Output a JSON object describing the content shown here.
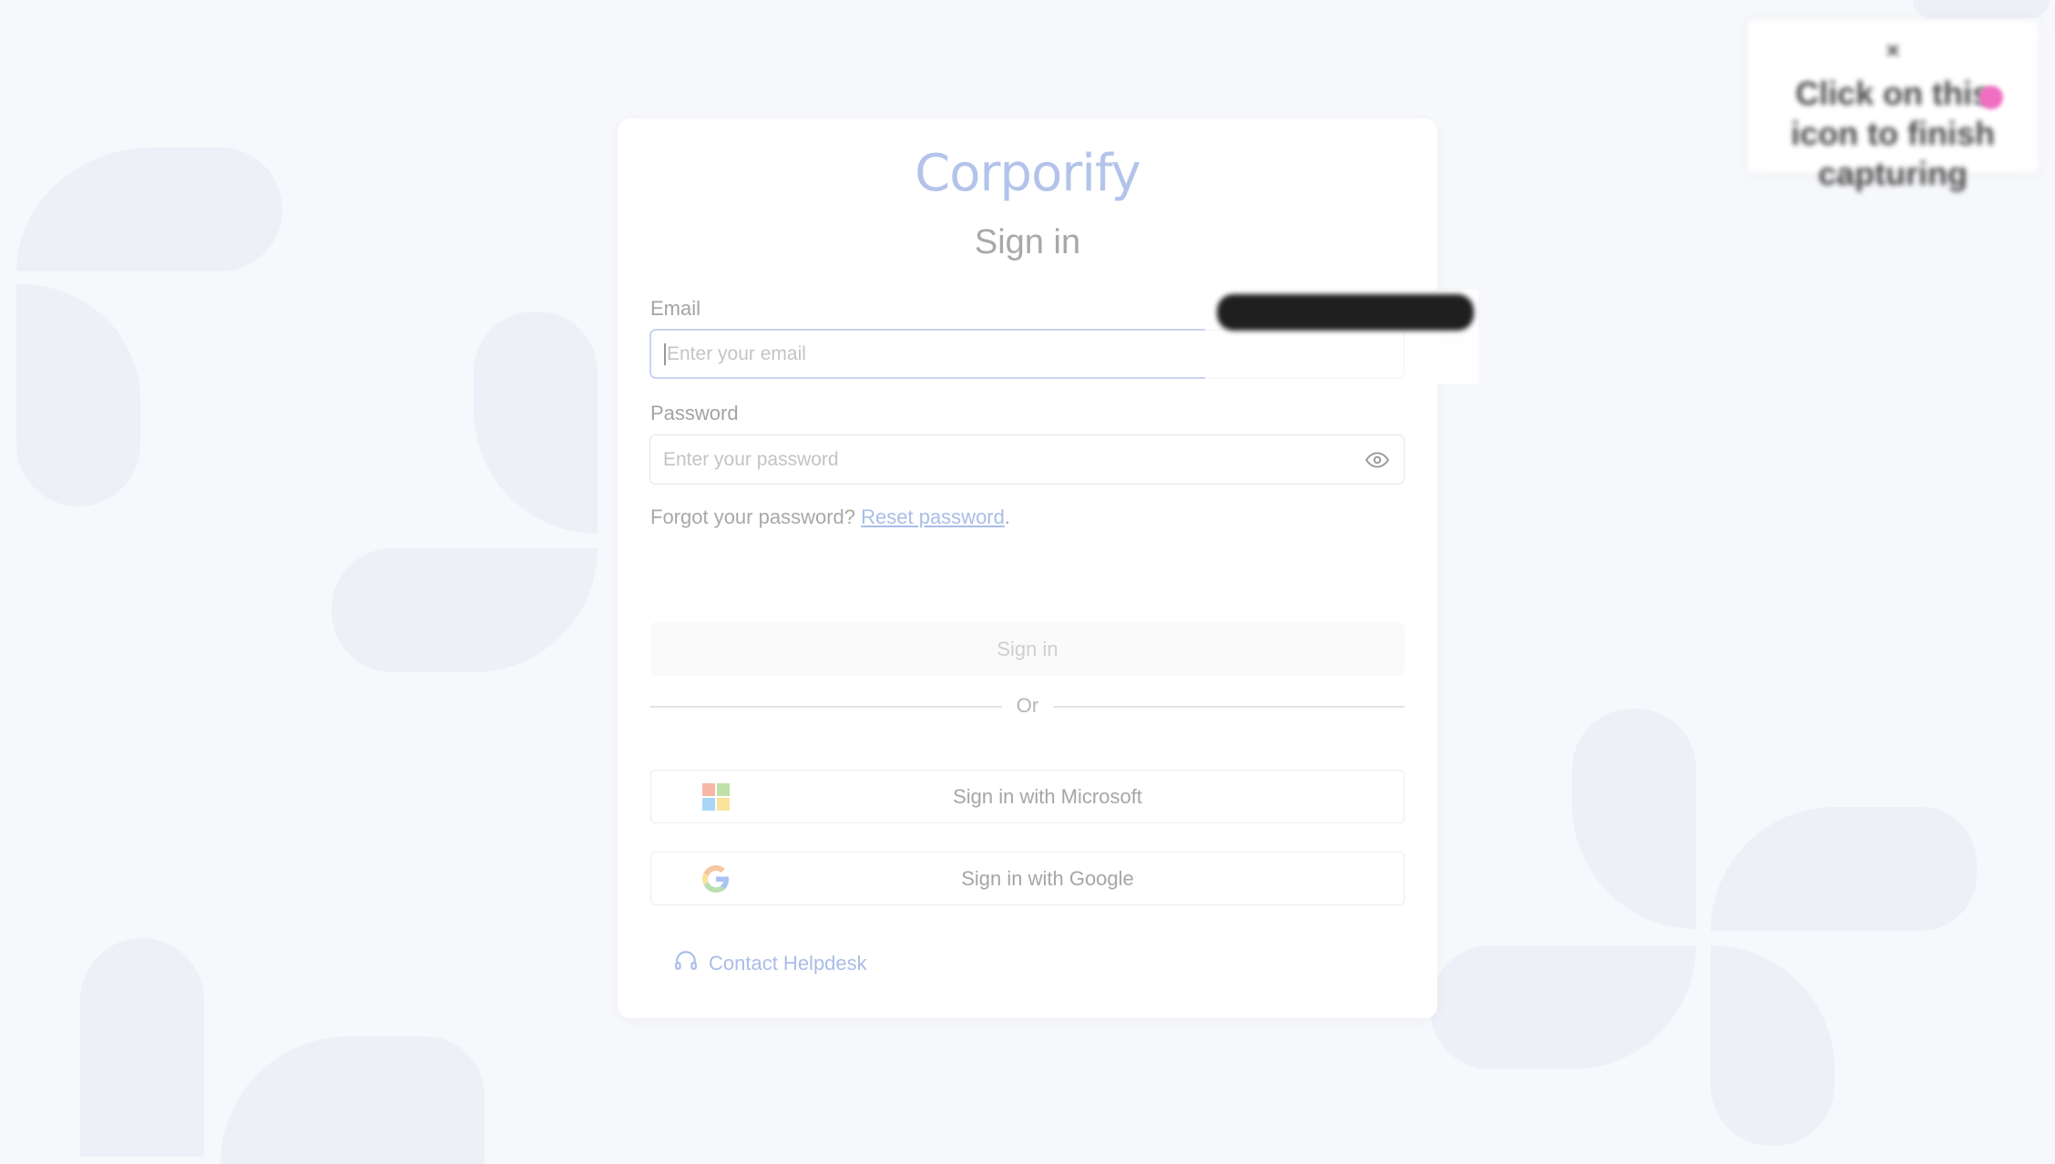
{
  "brand": {
    "logo_text": "Corporify"
  },
  "form": {
    "title": "Sign in",
    "email_label": "Email",
    "email_placeholder": "Enter your email",
    "password_label": "Password",
    "password_placeholder": "Enter your password",
    "forgot_text": "Forgot your password?",
    "reset_link": "Reset password",
    "reset_suffix": ".",
    "signin_button": "Sign in",
    "divider_text": "Or"
  },
  "oauth": {
    "microsoft_label": "Sign in with Microsoft",
    "google_label": "Sign in with Google"
  },
  "footer": {
    "helpdesk_label": "Contact Helpdesk"
  },
  "capture_popup": {
    "close_glyph": "×",
    "message": "Click on this icon to finish capturing"
  },
  "colors": {
    "accent": "#b3c3ea",
    "link": "#a9bde8",
    "background": "#f7f8fb",
    "shape": "#edf0f7",
    "capture_dot": "#ef6ec2"
  },
  "icons": [
    "eye-icon",
    "microsoft-icon",
    "google-icon",
    "headset-icon",
    "close-icon"
  ]
}
